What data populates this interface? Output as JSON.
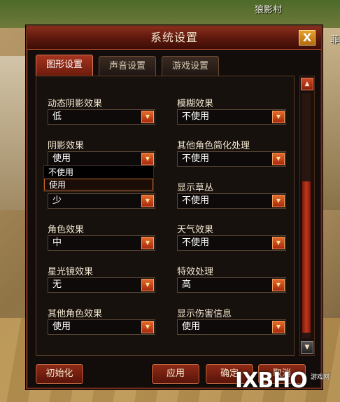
{
  "scene": {
    "village_name": "狼影村",
    "edge_text": "菲"
  },
  "dialog": {
    "title": "系统设置",
    "close_label": "X",
    "tabs": [
      {
        "label": "图形设置",
        "active": true
      },
      {
        "label": "声音设置",
        "active": false
      },
      {
        "label": "游戏设置",
        "active": false
      }
    ],
    "settings_left": [
      {
        "label": "动态阴影效果",
        "value": "低"
      },
      {
        "label": "阴影效果",
        "value": "使用"
      },
      {
        "label": "",
        "value": "少"
      },
      {
        "label": "角色效果",
        "value": "中"
      },
      {
        "label": "星光镜效果",
        "value": "无"
      },
      {
        "label": "其他角色效果",
        "value": "使用"
      }
    ],
    "settings_right": [
      {
        "label": "模糊效果",
        "value": "不使用"
      },
      {
        "label": "其他角色简化处理",
        "value": "不使用"
      },
      {
        "label": "显示草丛",
        "value": "不使用"
      },
      {
        "label": "天气效果",
        "value": "不使用"
      },
      {
        "label": "特效处理",
        "value": "高"
      },
      {
        "label": "显示伤害信息",
        "value": "使用"
      }
    ],
    "open_dropdown_options": [
      "不使用",
      "使用"
    ],
    "open_dropdown_highlighted": "使用",
    "buttons": {
      "init": "初始化",
      "apply": "应用",
      "confirm": "确定",
      "cancel": "取消"
    },
    "scroll_up": "▲",
    "scroll_down": "▼",
    "dropdown_arrow": "▼"
  },
  "watermark": {
    "text": "IXBHO",
    "sub": "游戏网"
  }
}
